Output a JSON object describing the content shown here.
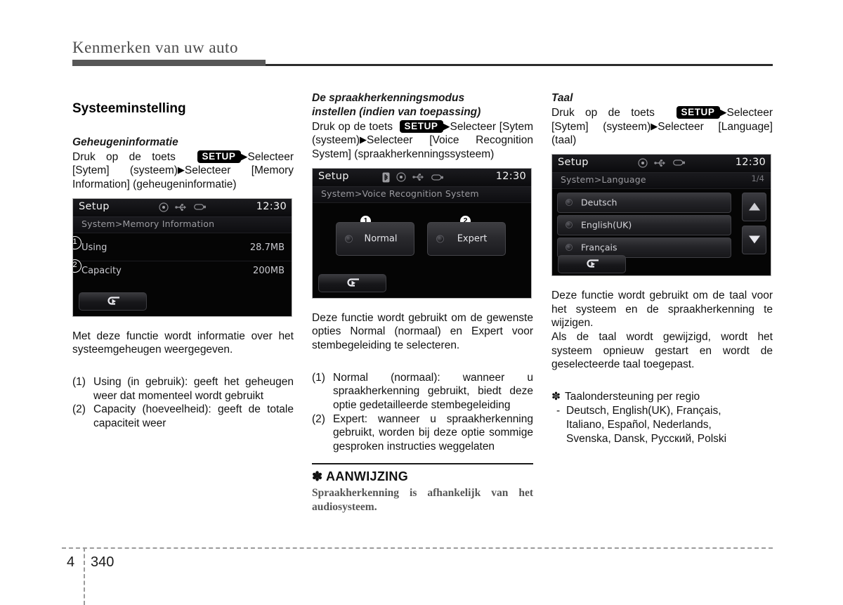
{
  "header": {
    "title": "Kenmerken van uw auto"
  },
  "footer": {
    "chapter": "4",
    "page": "340"
  },
  "columns": {
    "left": {
      "section_title": "Systeeminstelling",
      "sub_title": "Geheugeninformatie",
      "instruction_pre": "Druk op de toets",
      "setup_key": "SETUP",
      "instruction_post": "Selecteer [Sytem] (systeem)",
      "instruction_post2": "Selecteer [Memory Information] (geheugeninformatie)",
      "description": "Met deze functie wordt informatie over het systeemgeheugen weergegeven.",
      "items": [
        {
          "marker": "(1)",
          "text": "Using (in gebruik): geeft het geheugen weer dat momenteel wordt gebruikt"
        },
        {
          "marker": "(2)",
          "text": "Capacity (hoeveelheid): geeft de totale capaciteit weer"
        }
      ],
      "device": {
        "title": "Setup",
        "clock": "12:30",
        "breadcrumb": "System>Memory Information",
        "icons": [
          "disc-icon",
          "usb-icon",
          "device-icon"
        ],
        "rows": [
          {
            "callout": "1",
            "label": "Using",
            "value": "28.7MB"
          },
          {
            "callout": "2",
            "label": "Capacity",
            "value": "200MB"
          }
        ],
        "back_button": "back-arrow-icon"
      }
    },
    "middle": {
      "sub_title_line1": "De spraakherkenningsmodus",
      "sub_title_line2": "instellen  (indien van toepassing)",
      "instruction_pre": "Druk op de toets",
      "setup_key": "SETUP",
      "instruction_post": "Selecteer [Sytem (systeem)",
      "instruction_post2": "Selecteer [Voice Recognition System] (spraakherkenningssysteem)",
      "description": "Deze functie wordt gebruikt om de gewenste opties Normal (normaal) en Expert voor stembegeleiding te selecteren.",
      "items": [
        {
          "marker": "(1)",
          "text": "Normal (normaal): wanneer u spraakherkenning gebruikt, biedt deze optie gedetailleerde stembegeleiding"
        },
        {
          "marker": "(2)",
          "text": "Expert: wanneer u spraakherkenning gebruikt, worden bij deze optie sommige gesproken instructies weggelaten"
        }
      ],
      "note": {
        "symbol": "✽",
        "title": "AANWIJZING",
        "body": "Spraakherkenning is afhankelijk van het audiosysteem."
      },
      "device": {
        "title": "Setup",
        "clock": "12:30",
        "breadcrumb": "System>Voice Recognition System",
        "icons": [
          "bluetooth-icon",
          "disc-icon",
          "usb-icon",
          "device-icon"
        ],
        "options": [
          {
            "callout": "1",
            "label": "Normal"
          },
          {
            "callout": "2",
            "label": "Expert"
          }
        ],
        "back_button": "back-arrow-icon"
      }
    },
    "right": {
      "sub_title": "Taal",
      "instruction_pre": "Druk op de toets",
      "setup_key": "SETUP",
      "instruction_post": "Selecteer [Sytem]",
      "instruction_post2": "(systeem)",
      "instruction_post3": "Selecteer [Language] (taal)",
      "description_1": "Deze functie wordt gebruikt om de taal voor het systeem en de spraakherkenning te wijzigen.",
      "description_2": "Als de taal wordt gewijzigd, wordt het systeem opnieuw gestart en wordt de geselecteerde taal toegepast.",
      "note_symbol": "✽",
      "note_title": "Taalondersteuning per regio",
      "note_bullet": "-",
      "note_lines": [
        "Deutsch, English(UK), Français,",
        "Italiano, Español, Nederlands,",
        "Svenska, Dansk, Русский, Polski"
      ],
      "device": {
        "title": "Setup",
        "clock": "12:30",
        "breadcrumb": "System>Language",
        "page_indicator": "1/4",
        "icons": [
          "disc-icon",
          "usb-icon",
          "device-icon"
        ],
        "languages": [
          "Deutsch",
          "English(UK)",
          "Français"
        ],
        "scroll_up": "triangle-up-icon",
        "scroll_down": "triangle-down-icon",
        "back_button": "back-arrow-icon"
      }
    }
  }
}
